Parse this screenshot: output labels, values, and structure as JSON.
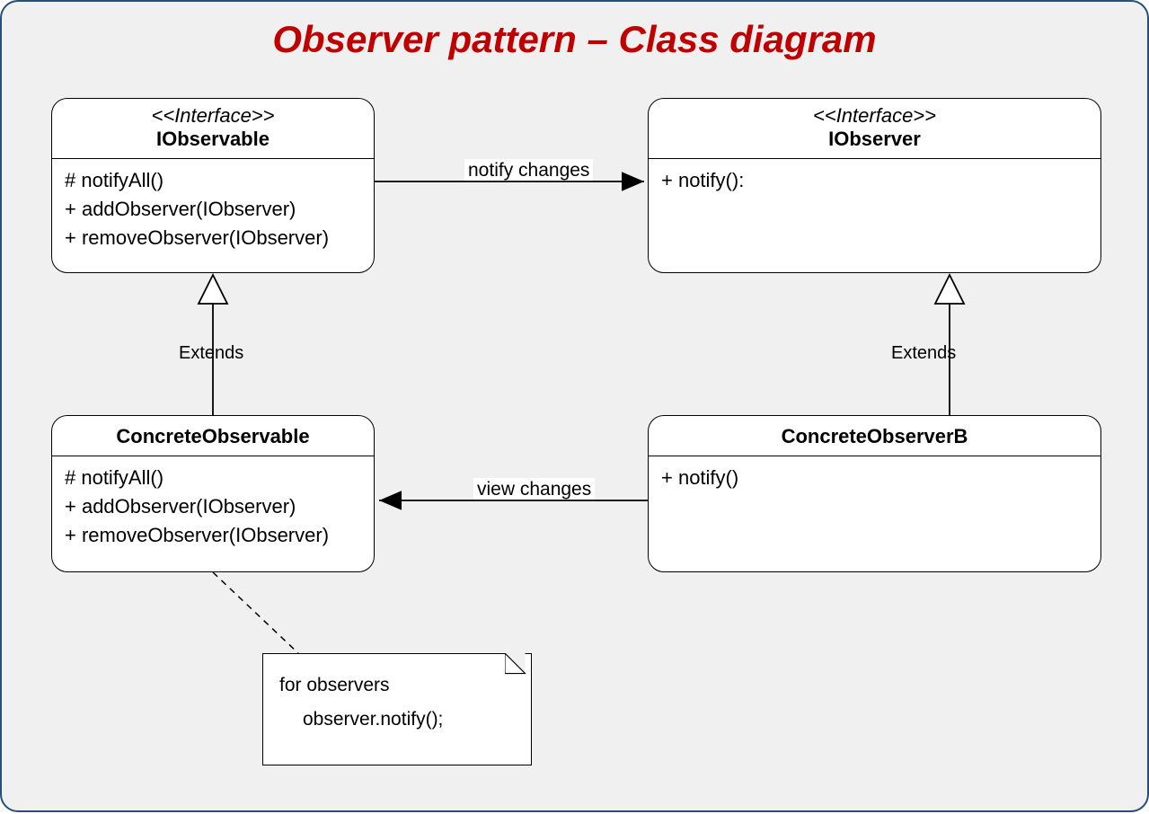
{
  "title": "Observer pattern – Class diagram",
  "classes": {
    "iobservable": {
      "stereotype": "<<Interface>>",
      "name": "IObservable",
      "members": "# notifyAll()\n+ addObserver(IObserver)\n+ removeObserver(IObserver)"
    },
    "iobserver": {
      "stereotype": "<<Interface>>",
      "name": "IObserver",
      "members": "+ notify():"
    },
    "concreteobservable": {
      "name": "ConcreteObservable",
      "members": "# notifyAll()\n+ addObserver(IObserver)\n+ removeObserver(IObserver)"
    },
    "concreteobserverb": {
      "name": "ConcreteObserverB",
      "members": "+ notify()"
    }
  },
  "relations": {
    "notify": "notify changes",
    "view": "view changes",
    "extends_left": "Extends",
    "extends_right": "Extends"
  },
  "note": {
    "line1": "for observers",
    "line2": "observer.notify();"
  }
}
